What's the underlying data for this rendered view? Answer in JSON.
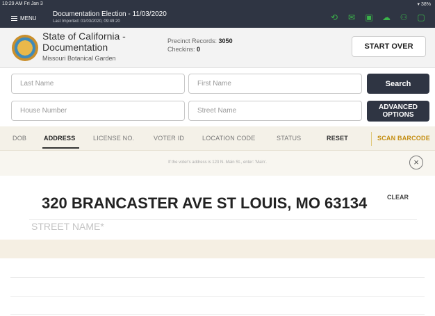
{
  "status_bar": {
    "time": "10:29 AM  Fri Jan 3",
    "battery": "38%"
  },
  "topbar": {
    "menu_label": "MENU",
    "election_title": "Documentation Election - 11/03/2020",
    "last_imported": "Last Imported: 01/03/2020, 09:49:20",
    "icons": [
      "history-icon",
      "mail-icon",
      "device-icon",
      "cloud-icon",
      "users-icon",
      "chat-icon"
    ]
  },
  "header": {
    "state_name": "State of California - Documentation",
    "location": "Missouri Botanical Garden",
    "precinct_label": "Precinct Records:",
    "precinct_value": "3050",
    "checkins_label": "Checkins:",
    "checkins_value": "0",
    "start_over": "START OVER"
  },
  "search": {
    "last_name_placeholder": "Last Name",
    "first_name_placeholder": "First Name",
    "house_number_placeholder": "House Number",
    "street_name_placeholder": "Street Name",
    "search_button": "Search",
    "advanced_line1": "ADVANCED",
    "advanced_line2": "OPTIONS"
  },
  "tabs": {
    "items": [
      "DOB",
      "ADDRESS",
      "LICENSE NO.",
      "VOTER ID",
      "LOCATION CODE",
      "STATUS"
    ],
    "active": "ADDRESS",
    "reset": "RESET",
    "scan": "SCAN BARCODE"
  },
  "hint": {
    "text": "If the voter's address is 123 N. Main St., enter: 'Main'."
  },
  "address_entry": {
    "value": "320 BRANCASTER AVE ST LOUIS, MO 63134",
    "clear": "CLEAR",
    "label": "STREET NAME*"
  },
  "colors": {
    "navy": "#2f3543",
    "tab_bg": "#f4f1e8",
    "scan_accent": "#c48e12",
    "icon_green": "#3bb34a"
  }
}
